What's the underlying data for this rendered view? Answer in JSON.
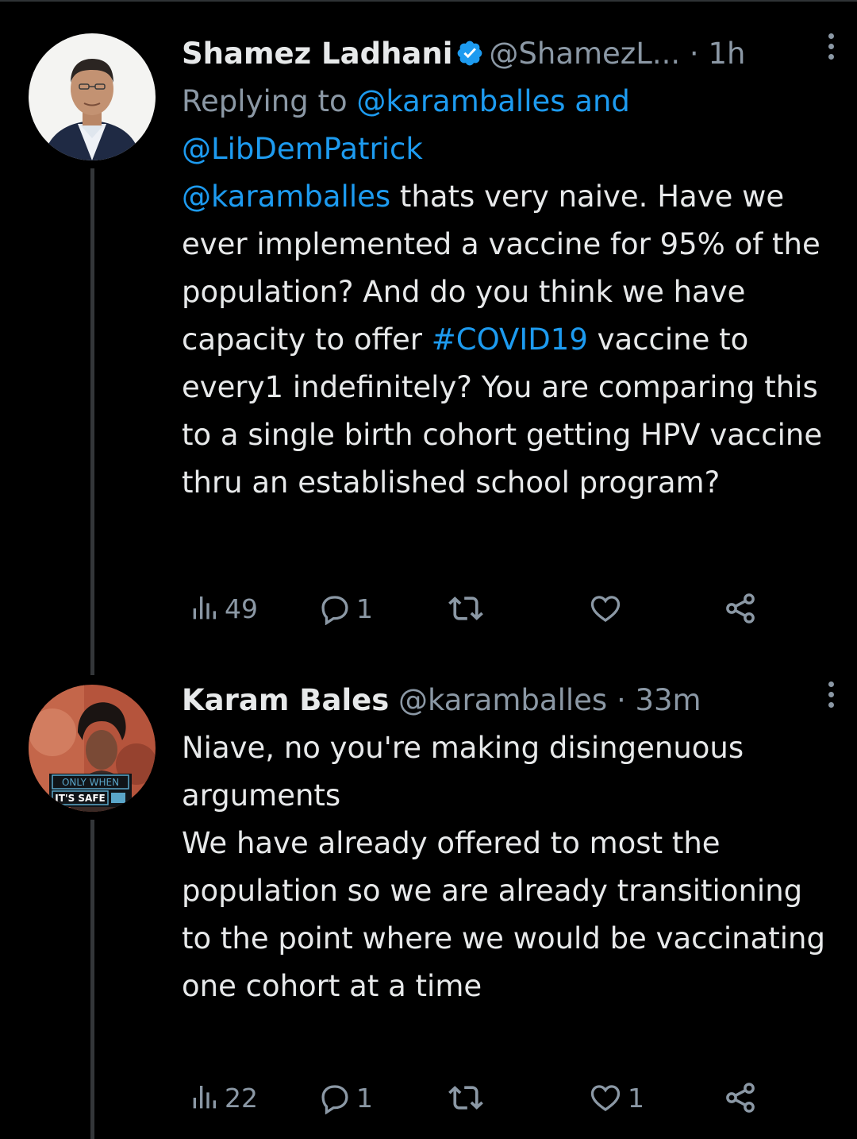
{
  "tweets": [
    {
      "display_name": "Shamez Ladhani",
      "handle": "@ShamezL...",
      "separator": "·",
      "time": "1h",
      "verified": true,
      "replying_prefix": "Replying to",
      "replying_user1": "@karamballes",
      "replying_and": "and",
      "replying_user2": "@LibDemPatrick",
      "body_mention": "@karamballes",
      "body_part1": " thats very naive. Have we ever implemented a vaccine for 95% of the population? And do you think we have capacity to offer ",
      "body_hashtag": "#COVID19",
      "body_part2": " vaccine to every1 indefinitely? You are comparing this to a single birth cohort getting HPV vaccine thru an established school program?",
      "actions": {
        "views": "49",
        "replies": "1",
        "retweets": "",
        "likes": ""
      }
    },
    {
      "display_name": "Karam Bales",
      "handle": "@karamballes",
      "separator": "·",
      "time": "33m",
      "verified": false,
      "body": "Niave, no you're making disingenuous arguments\nWe have already offered to most the population so we are already transitioning to the point where we would be vaccinating one cohort at a time",
      "avatar_badge_line1": "ONLY WHEN",
      "avatar_badge_line2": "IT'S SAFE",
      "actions": {
        "views": "22",
        "replies": "1",
        "retweets": "",
        "likes": "1"
      }
    }
  ],
  "colors": {
    "background": "#000000",
    "text": "#e7e9ea",
    "muted": "#8b98a5",
    "accent": "#1d9bf0",
    "thread_line": "#333639"
  },
  "icons": [
    "verified-badge-icon",
    "more-options-icon",
    "views-icon",
    "reply-icon",
    "retweet-icon",
    "like-icon",
    "share-icon"
  ]
}
